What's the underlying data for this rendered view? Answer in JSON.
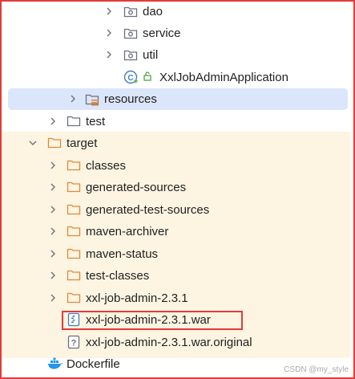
{
  "tree": {
    "rows": [
      {
        "label": "dao",
        "type": "package",
        "expanded": false
      },
      {
        "label": "service",
        "type": "package",
        "expanded": false
      },
      {
        "label": "util",
        "type": "package",
        "expanded": false
      },
      {
        "label": "XxlJobAdminApplication",
        "type": "spring-class"
      },
      {
        "label": "resources",
        "type": "resources-folder",
        "expanded": false,
        "selected": true
      },
      {
        "label": "test",
        "type": "folder",
        "expanded": false
      },
      {
        "label": "target",
        "type": "folder-orange",
        "expanded": true
      },
      {
        "label": "classes",
        "type": "folder-orange",
        "expanded": false
      },
      {
        "label": "generated-sources",
        "type": "folder-orange",
        "expanded": false
      },
      {
        "label": "generated-test-sources",
        "type": "folder-orange",
        "expanded": false
      },
      {
        "label": "maven-archiver",
        "type": "folder-orange",
        "expanded": false
      },
      {
        "label": "maven-status",
        "type": "folder-orange",
        "expanded": false
      },
      {
        "label": "test-classes",
        "type": "folder-orange",
        "expanded": false
      },
      {
        "label": "xxl-job-admin-2.3.1",
        "type": "folder-orange",
        "expanded": false
      },
      {
        "label": "xxl-job-admin-2.3.1.war",
        "type": "war-file",
        "highlighted": true
      },
      {
        "label": "xxl-job-admin-2.3.1.war.original",
        "type": "unknown-file"
      },
      {
        "label": "Dockerfile",
        "type": "docker-file"
      }
    ]
  },
  "watermark": "CSDN @my_style",
  "colors": {
    "highlight_border": "#e23b3b",
    "selection": "#dbe6fb",
    "excluded_bg": "#fdf5e2",
    "folder_orange": "#e0893a"
  }
}
